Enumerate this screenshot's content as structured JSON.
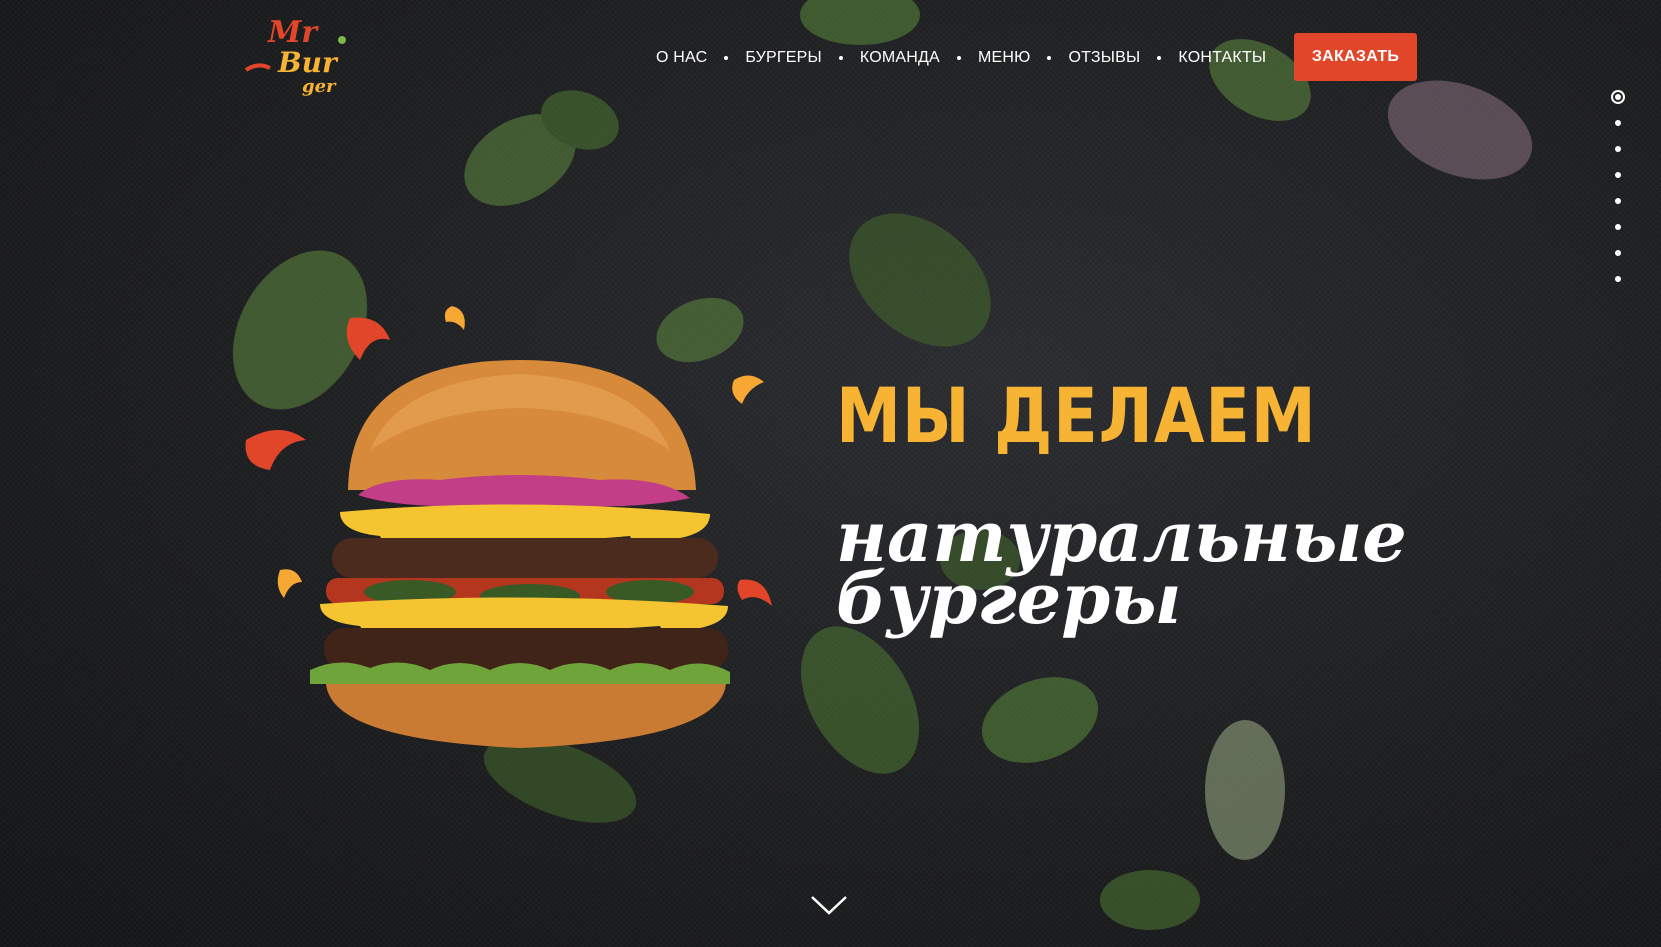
{
  "brand": {
    "logo_line1": "Mr",
    "logo_line2": "Bur",
    "logo_line3": "ger"
  },
  "nav": {
    "items": [
      {
        "label": "О НАС"
      },
      {
        "label": "БУРГЕРЫ"
      },
      {
        "label": "КОМАНДА"
      },
      {
        "label": "МЕНЮ"
      },
      {
        "label": "ОТЗЫВЫ"
      },
      {
        "label": "КОНТАКТЫ"
      }
    ],
    "order_label": "ЗАКАЗАТЬ"
  },
  "hero": {
    "headline": "МЫ ДЕЛАЕМ",
    "sub_line1": "натуральные",
    "sub_line2": "бургеры"
  },
  "side_nav": {
    "count": 8,
    "active_index": 0
  },
  "colors": {
    "accent_orange": "#e1462b",
    "headline_yellow": "#f7b334",
    "background": "#1b1c1e"
  }
}
